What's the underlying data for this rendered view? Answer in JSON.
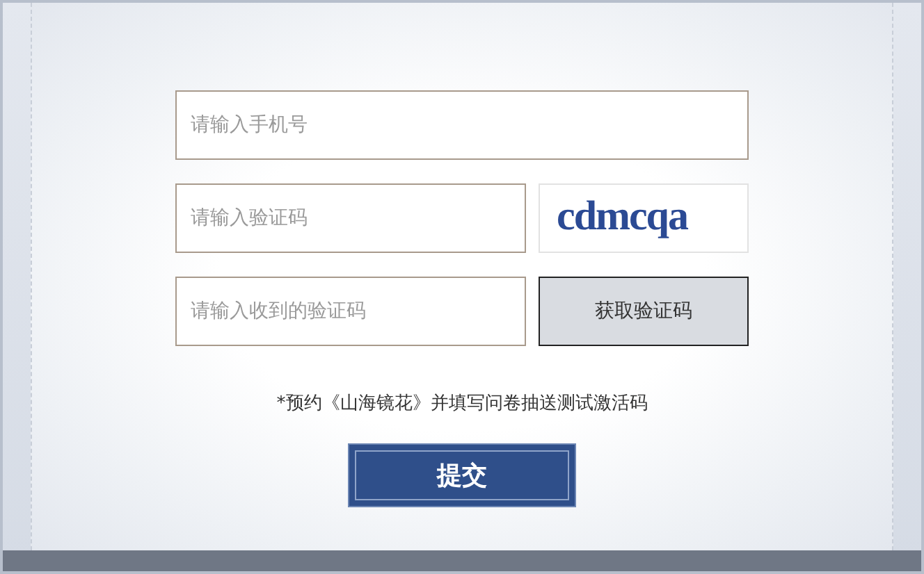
{
  "form": {
    "phone": {
      "placeholder": "请输入手机号"
    },
    "captcha_field": {
      "placeholder": "请输入验证码"
    },
    "captcha_image": {
      "text": "cdmcqa"
    },
    "sms_field": {
      "placeholder": "请输入收到的验证码"
    },
    "sms_button": "获取验证码",
    "note": "*预约《山海镜花》并填写问卷抽送测试激活码",
    "submit": "提交"
  }
}
